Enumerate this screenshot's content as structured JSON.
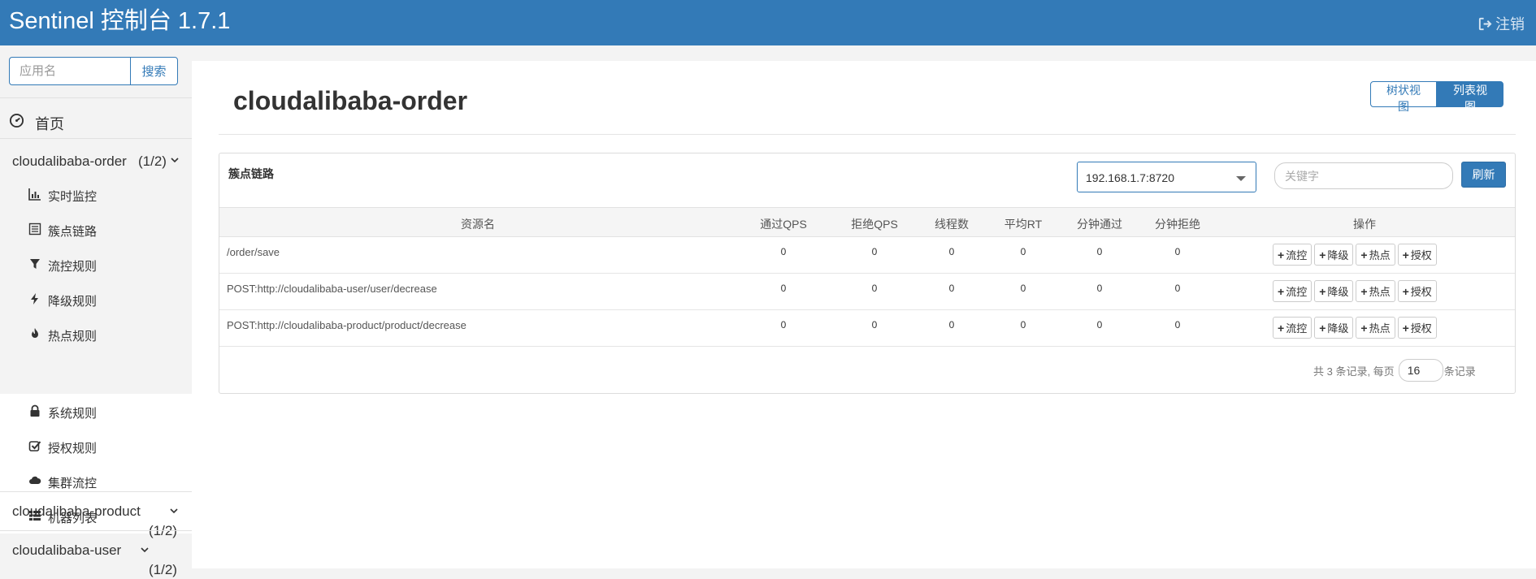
{
  "header": {
    "brand": "Sentinel 控制台 1.7.1",
    "logout_label": "注销"
  },
  "sidebar": {
    "search_placeholder": "应用名",
    "search_button": "搜索",
    "home_label": "首页",
    "apps": [
      {
        "name": "cloudalibaba-order",
        "count": "(1/2)",
        "expanded": true
      },
      {
        "name": "cloudalibaba-product",
        "count": "(1/2)",
        "expanded": false
      },
      {
        "name": "cloudalibaba-user",
        "count": "(1/2)",
        "expanded": false
      }
    ],
    "menu": [
      {
        "label": "实时监控",
        "icon": "bar-chart-icon"
      },
      {
        "label": "簇点链路",
        "icon": "list-alt-icon"
      },
      {
        "label": "流控规则",
        "icon": "filter-icon"
      },
      {
        "label": "降级规则",
        "icon": "flash-icon"
      },
      {
        "label": "热点规则",
        "icon": "fire-icon"
      },
      {
        "label": "系统规则",
        "icon": "lock-icon"
      },
      {
        "label": "授权规则",
        "icon": "check-icon"
      },
      {
        "label": "集群流控",
        "icon": "cloud-icon"
      },
      {
        "label": "机器列表",
        "icon": "th-list-icon"
      }
    ]
  },
  "main": {
    "title": "cloudalibaba-order",
    "view_tree": "树状视图",
    "view_list": "列表视图",
    "card_title": "簇点链路",
    "machine": "192.168.1.7:8720",
    "keyword_placeholder": "关键字",
    "refresh": "刷新",
    "columns": [
      "资源名",
      "通过QPS",
      "拒绝QPS",
      "线程数",
      "平均RT",
      "分钟通过",
      "分钟拒绝",
      "操作"
    ],
    "rows": [
      {
        "resource": "/order/save",
        "pass_qps": "0",
        "block_qps": "0",
        "threads": "0",
        "avg_rt": "0",
        "min_pass": "0",
        "min_block": "0"
      },
      {
        "resource": "POST:http://cloudalibaba-user/user/decrease",
        "pass_qps": "0",
        "block_qps": "0",
        "threads": "0",
        "avg_rt": "0",
        "min_pass": "0",
        "min_block": "0"
      },
      {
        "resource": "POST:http://cloudalibaba-product/product/decrease",
        "pass_qps": "0",
        "block_qps": "0",
        "threads": "0",
        "avg_rt": "0",
        "min_pass": "0",
        "min_block": "0"
      }
    ],
    "ops": [
      "流控",
      "降级",
      "热点",
      "授权"
    ],
    "pager": {
      "prefix": "共 3 条记录, 每页",
      "page_size": "16",
      "suffix": "条记录"
    }
  },
  "colors": {
    "primary": "#337ab7",
    "background": "#f3f3f3"
  }
}
